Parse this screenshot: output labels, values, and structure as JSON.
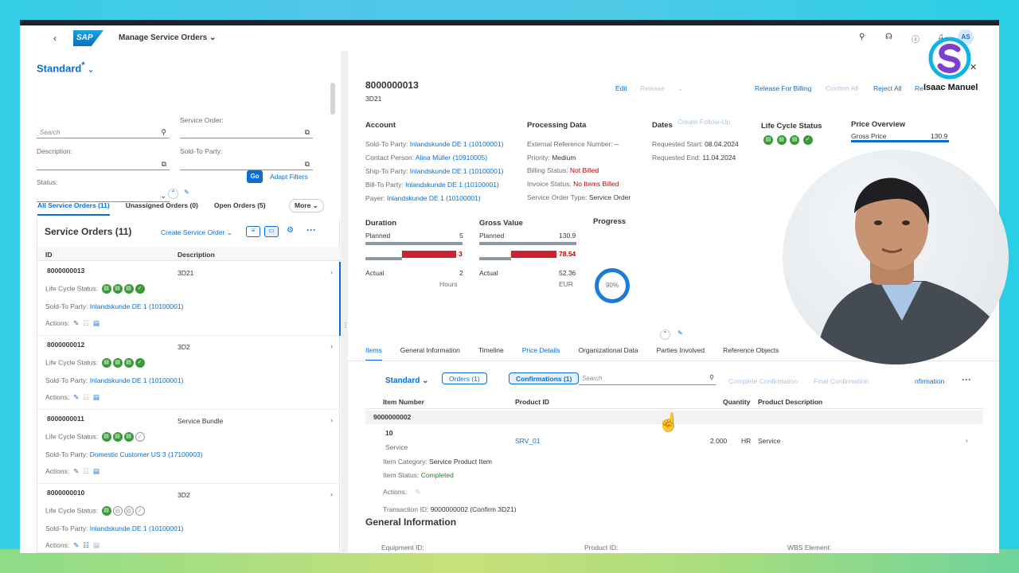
{
  "shell": {
    "title": "Manage Service Orders",
    "logo": "SAP",
    "avatar": "AS"
  },
  "filters": {
    "variant": "Standard",
    "variant_mark": "*",
    "search_placeholder": "Search",
    "service_order_label": "Service Order:",
    "description_label": "Description:",
    "sold_to_label": "Sold-To Party:",
    "status_label": "Status:",
    "go": "Go",
    "adapt": "Adapt Filters"
  },
  "left_tabs": [
    "All Service Orders (11)",
    "Unassigned Orders (0)",
    "Open Orders (5)"
  ],
  "more": "More",
  "list": {
    "title": "Service Orders (11)",
    "create": "Create Service Order",
    "col_id": "ID",
    "col_desc": "Description",
    "lc_label": "Life Cycle Status:",
    "sold_label": "Sold-To Party:",
    "actions_label": "Actions:",
    "rows": [
      {
        "id": "8000000013",
        "desc": "3D21",
        "sold": "Inlandskunde DE 1 (10100001)"
      },
      {
        "id": "8000000012",
        "desc": "3D2",
        "sold": "Inlandskunde DE 1 (10100001)"
      },
      {
        "id": "8000000011",
        "desc": "Service Bundle",
        "sold": "Domestic Customer US 3 (17100003)"
      },
      {
        "id": "8000000010",
        "desc": "3D2",
        "sold": "Inlandskunde DE 1 (10100001)"
      }
    ]
  },
  "detail": {
    "id": "8000000013",
    "sub": "3D21",
    "actions": [
      "Edit",
      "Release",
      "Create Follow-Up",
      "Release For Billing",
      "Confirm All",
      "Reject All",
      "Re"
    ],
    "account": {
      "title": "Account",
      "sold_to_l": "Sold-To Party:",
      "sold_to": "Inlandskunde DE 1 (10100001)",
      "contact_l": "Contact Person:",
      "contact": "Alina Müller (10910005)",
      "ship_l": "Ship-To Party:",
      "ship": "Inlandskunde DE 1 (10100001)",
      "bill_l": "Bill-To Party:",
      "bill": "Inlandskunde DE 1 (10100001)",
      "payer_l": "Payer:",
      "payer": "Inlandskunde DE 1 (10100001)"
    },
    "processing": {
      "title": "Processing Data",
      "ext_l": "External Reference Number:",
      "ext": "–",
      "prio_l": "Priority:",
      "prio": "Medium",
      "billing_l": "Billing Status:",
      "billing": "Not Billed",
      "invoice_l": "Invoice Status:",
      "invoice": "No Items Billed",
      "type_l": "Service Order Type:",
      "type": "Service Order"
    },
    "dates": {
      "title": "Dates",
      "start_l": "Requested Start:",
      "start": "08.04.2024",
      "end_l": "Requested End:",
      "end": "11.04.2024"
    },
    "lifecycle": {
      "title": "Life Cycle Status"
    },
    "price": {
      "title": "Price Overview",
      "gross_l": "Gross Price",
      "gross": "130.9"
    },
    "duration": {
      "title": "Duration",
      "planned_l": "Planned",
      "planned": "5",
      "diff": "3",
      "actual_l": "Actual",
      "actual": "2",
      "unit": "Hours"
    },
    "gross": {
      "title": "Gross Value",
      "planned_l": "Planned",
      "planned": "130.9",
      "diff": "78.54",
      "actual_l": "Actual",
      "actual": "52.36",
      "unit": "EUR"
    },
    "progress": {
      "title": "Progress",
      "value": "90%"
    },
    "tabs": [
      "Items",
      "General Information",
      "Timeline",
      "Price Details",
      "Organizational Data",
      "Parties Involved",
      "Reference Objects"
    ],
    "items": {
      "variant": "Standard",
      "seg_orders": "Orders (1)",
      "seg_conf": "Confirmations (1)",
      "search": "Search",
      "complete": "Complete Confirmation",
      "final": "Final Confirmation",
      "last": "nfirmation",
      "col_item": "Item Number",
      "col_product": "Product ID",
      "col_qty": "Quantity",
      "col_pdesc": "Product Description",
      "group": "9000000002",
      "item_no": "10",
      "item_type": "Service",
      "product": "SRV_01",
      "qty": "2.000",
      "uom": "HR",
      "pdesc": "Service",
      "cat_l": "Item Category:",
      "cat": "Service Product Item",
      "status_l": "Item Status:",
      "status": "Completed",
      "actions_l": "Actions:",
      "txn_l": "Transaction ID:",
      "txn": "9000000002 (Confirm 3D21)"
    },
    "general": {
      "title": "General Information",
      "equip": "Equipment ID:",
      "product": "Product ID:",
      "wbs": "WBS Element:"
    }
  },
  "overlay": {
    "name": "Isaac Manuel"
  },
  "colors": {
    "accent": "#0a6ed1",
    "success": "#3a9a3a",
    "error": "#bb0000"
  }
}
